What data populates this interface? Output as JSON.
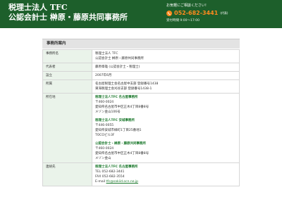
{
  "header": {
    "logo_line1": "税理士法人 TFC",
    "logo_line2": "公認会計士 榊原・藤原共同事務所",
    "contact_label": "お気軽にご相談ください!",
    "phone": "052-682-3441",
    "phone_note": "(代表)",
    "hours": "受付時間 9:00〜17:00",
    "colors": {
      "header_bg": "#1d5f2b",
      "phone": "#ff8a1e",
      "accent": "#1d7a2e"
    }
  },
  "section": {
    "title": "事務所案内"
  },
  "table": {
    "rows": [
      {
        "label": "事務所名",
        "lines": [
          "税理士法人 TFC",
          "公認会計士 榊原・藤原共同事務所"
        ]
      },
      {
        "label": "代表者",
        "lines": [
          "藤原章雄 (公認会計士・税理士)"
        ]
      },
      {
        "label": "設立",
        "lines": [
          "2007年6月"
        ]
      },
      {
        "label": "所属",
        "lines": [
          "名古屋税理士会名古屋中支部 登録番号1438",
          "東海税理士会刈谷支部 登録番号1438-1"
        ]
      }
    ],
    "location": {
      "label": "所在地",
      "offices": [
        {
          "name": "税理士法人TFC 名古屋事務所",
          "lines": [
            "〒460-0024",
            "愛知県名古屋市中区正木4丁目8番8号",
            "メゾン金山106号"
          ]
        },
        {
          "name": "税理士法人TFC 安城事務所",
          "lines": [
            "〒446-0055",
            "愛知県安城市緑町1丁目25番地1",
            "TOCOビル3F"
          ]
        },
        {
          "name": "公認会計士・榊原・藤原共同事務所",
          "lines": [
            "〒460-0024",
            "愛知県名古屋市中区正木4丁目8番8号",
            "メゾン金山"
          ]
        }
      ]
    },
    "contact": {
      "label": "連絡先",
      "office": "税理士法人TFC 名古屋事務所",
      "tel": "TEL 052-682-3441",
      "fax": "FAX 052-682-3554",
      "email_prefix": "E-mail ",
      "email": "tfc@sakiid.ocn.ne.jp"
    }
  }
}
